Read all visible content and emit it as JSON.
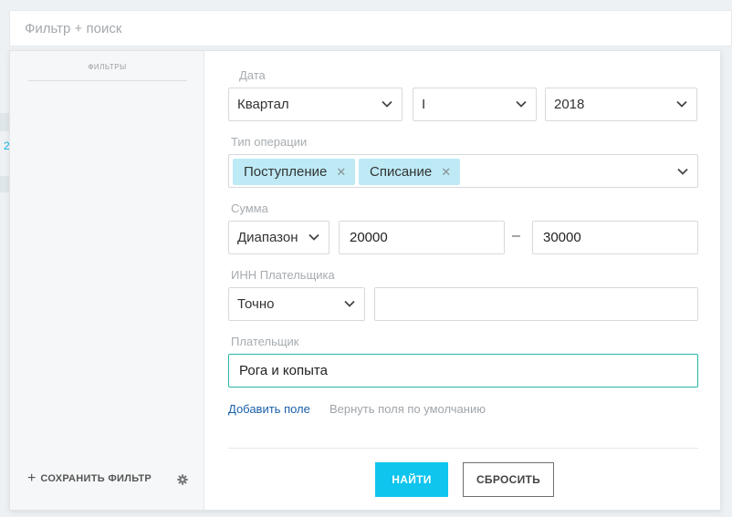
{
  "search": {
    "placeholder": "Фильтр + поиск"
  },
  "background": {
    "mark": "2"
  },
  "sidebar": {
    "title": "ФИЛЬТРЫ",
    "save_icon": "plus-icon",
    "save_label": "СОХРАНИТЬ ФИЛЬТР",
    "settings_icon": "gear-icon"
  },
  "form": {
    "date": {
      "label": "Дата",
      "period": "Квартал",
      "quarter": "I",
      "year": "2018"
    },
    "operation_type": {
      "label": "Тип операции",
      "tags": [
        "Поступление",
        "Списание"
      ],
      "remove_icon": "close-icon"
    },
    "amount": {
      "label": "Сумма",
      "mode": "Диапазон",
      "from": "20000",
      "separator": "–",
      "to": "30000"
    },
    "inn": {
      "label": "ИНН Плательщика",
      "mode": "Точно",
      "value": ""
    },
    "payer": {
      "label": "Плательщик",
      "value": "Рога и копыта"
    },
    "add_field": "Добавить поле",
    "reset_fields": "Вернуть поля по умолчанию",
    "find_button": "НАЙТИ",
    "reset_button": "СБРОСИТЬ"
  },
  "colors": {
    "accent": "#0fc5ee",
    "tag_bg": "#bdeaf5",
    "focus_border": "#25b7a6",
    "link": "#1b5fa8"
  }
}
